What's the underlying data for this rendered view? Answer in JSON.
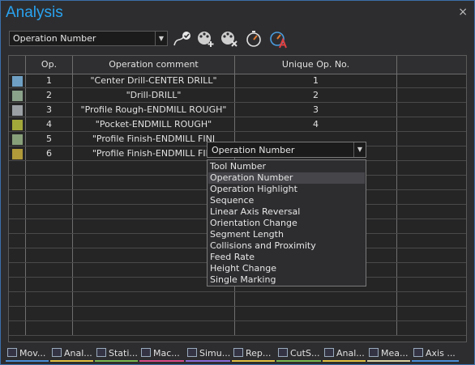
{
  "window": {
    "title": "Analysis",
    "close_glyph": "×"
  },
  "toolbar": {
    "mode_value": "Operation Number",
    "buttons": [
      {
        "name": "path-check-icon"
      },
      {
        "name": "palette-add-icon"
      },
      {
        "name": "palette-remove-icon"
      },
      {
        "name": "gauge-icon"
      },
      {
        "name": "gauge-text-icon"
      }
    ]
  },
  "table": {
    "headers": [
      "Op.",
      "Operation comment",
      "Unique Op. No."
    ],
    "rows": [
      {
        "color": "#6fa0c4",
        "op": "1",
        "comment": "\"Center Drill-CENTER DRILL\"",
        "unique": "1"
      },
      {
        "color": "#8aa28a",
        "op": "2",
        "comment": "\"Drill-DRILL\"",
        "unique": "2"
      },
      {
        "color": "#9aa0a4",
        "op": "3",
        "comment": "\"Profile Rough-ENDMILL ROUGH\"",
        "unique": "3"
      },
      {
        "color": "#a3a83a",
        "op": "4",
        "comment": "\"Pocket-ENDMILL ROUGH\"",
        "unique": "4"
      },
      {
        "color": "#88a07a",
        "op": "5",
        "comment": "\"Profile Finish-ENDMILL FINI",
        "unique": ""
      },
      {
        "color": "#b09a3a",
        "op": "6",
        "comment": "\"Profile Finish-ENDMILL FINI",
        "unique": ""
      }
    ]
  },
  "dropdown": {
    "value": "Operation Number",
    "selected_index": 1,
    "options": [
      "Tool Number",
      "Operation Number",
      "Operation Highlight",
      "Sequence",
      "Linear Axis Reversal",
      "Orientation Change",
      "Segment Length",
      "Collisions and Proximity",
      "Feed Rate",
      "Height Change",
      "Single Marking"
    ]
  },
  "tabs": [
    {
      "label": "Mov...",
      "color": "#4a8fd8"
    },
    {
      "label": "Anal...",
      "color": "#e0c040"
    },
    {
      "label": "Stati...",
      "color": "#7ab850"
    },
    {
      "label": "Mac...",
      "color": "#d84a8a"
    },
    {
      "label": "Simu...",
      "color": "#8a6ad8"
    },
    {
      "label": "Rep...",
      "color": "#e0c040"
    },
    {
      "label": "CutS...",
      "color": "#7ab850"
    },
    {
      "label": "Anal...",
      "color": "#e0c040"
    },
    {
      "label": "Mea...",
      "color": "#d8d0a0"
    },
    {
      "label": "Axis ...",
      "color": "#4a8fd8"
    }
  ]
}
